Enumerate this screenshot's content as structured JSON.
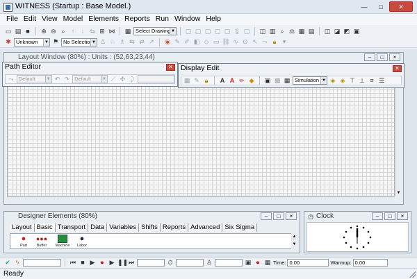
{
  "window": {
    "title": "WITNESS (Startup : Base Model.)",
    "minimize": "—",
    "maximize": "□",
    "close": "✕"
  },
  "menu": [
    "File",
    "Edit",
    "View",
    "Model",
    "Elements",
    "Reports",
    "Run",
    "Window",
    "Help"
  ],
  "toolbar": {
    "drawing_select": "Select Drawing",
    "display_mode": "Unknown",
    "selection": "No Selection"
  },
  "layout_window": {
    "title": "Layout Window (80%) : Units : (52,63,23,44)"
  },
  "path_editor": {
    "title": "Path Editor",
    "combo1": "Default",
    "combo2": "Default"
  },
  "display_edit": {
    "title": "Display Edit",
    "layer": "Simulation Lay"
  },
  "designer": {
    "title": "Designer Elements (80%)",
    "tabs": [
      "Layout",
      "Basic",
      "Transport",
      "Data",
      "Variables",
      "Shifts",
      "Reports",
      "Advanced",
      "Six Sigma"
    ],
    "active_tab": "Basic",
    "elements": [
      "Part",
      "Buffer",
      "Machine",
      "Labor"
    ]
  },
  "clock": {
    "title": "Clock"
  },
  "runbar": {
    "time_label": "Time:",
    "time_value": "0.00",
    "warmup_label": "Warmup:",
    "warmup_value": "0.00"
  },
  "status": {
    "text": "Ready"
  }
}
